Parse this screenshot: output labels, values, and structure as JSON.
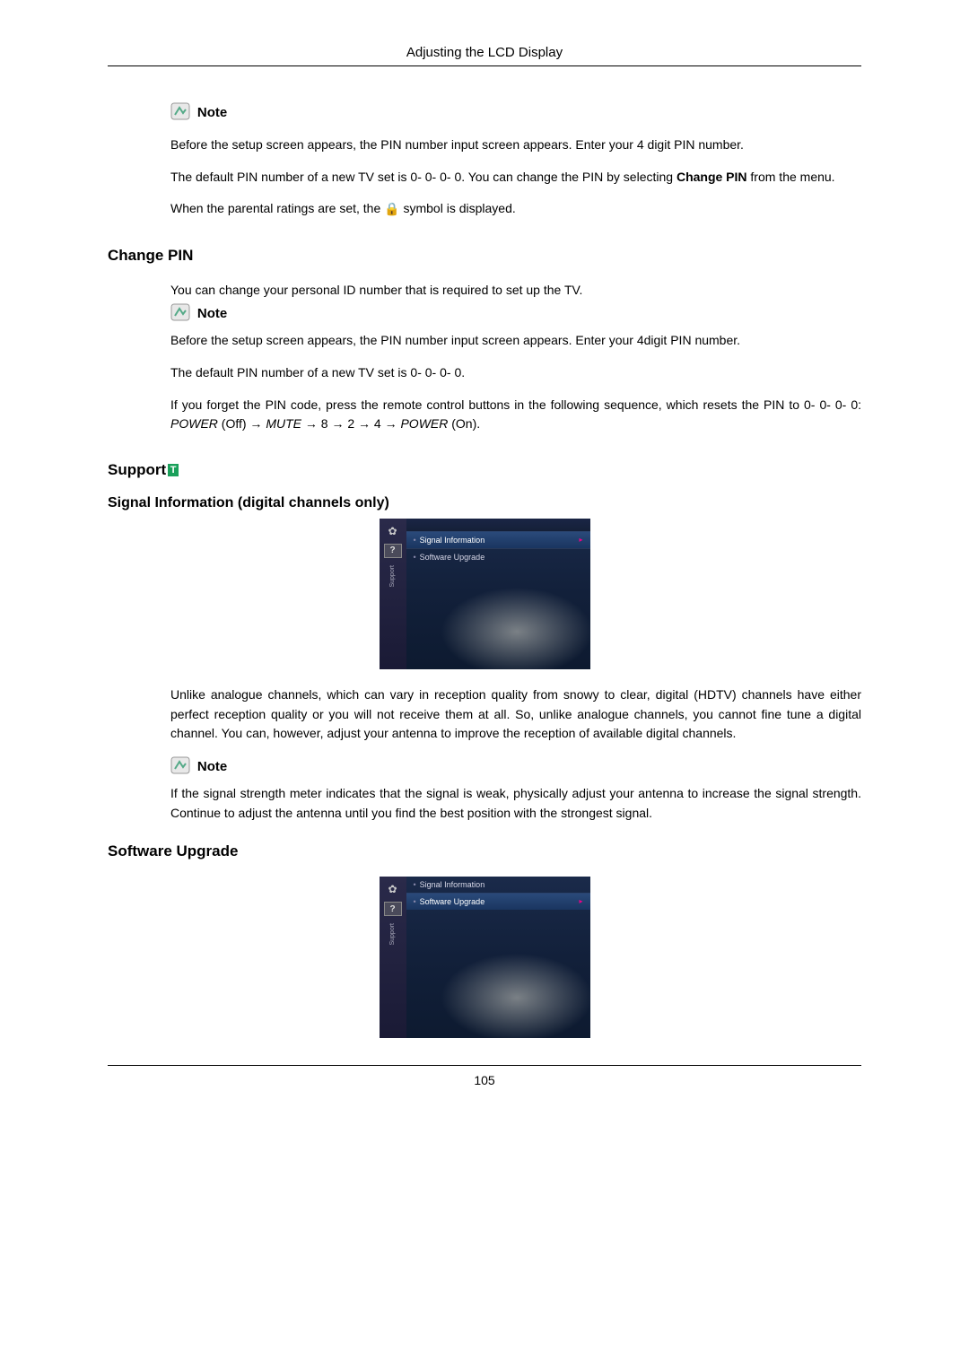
{
  "header": {
    "title": "Adjusting the LCD Display"
  },
  "note1": {
    "label": "Note",
    "p1_a": "Before the setup screen appears, the PIN number input screen appears. Enter your 4 digit PIN number.",
    "p2_a": "The default PIN number of a new TV set is 0- 0- 0- 0. You can change the PIN by selecting ",
    "p2_bold": "Change PIN",
    "p2_b": " from the menu.",
    "p3_a": "When the parental ratings are set, the ",
    "p3_b": " symbol is displayed."
  },
  "changepin": {
    "heading": "Change PIN",
    "p1": "You can change your personal ID number that is required to set up the TV.",
    "note_label": "Note",
    "p2": "Before the setup screen appears, the PIN number input screen appears. Enter your 4digit PIN number.",
    "p3": "The default PIN number of a new TV set is 0- 0- 0- 0.",
    "p4_a": "If you forget the PIN code, press the remote control buttons in the following sequence, which resets the PIN to 0- 0- 0- 0: ",
    "p4_i1": "POWER",
    "p4_b": " (Off) → ",
    "p4_i2": "MUTE",
    "p4_c": " → 8 → 2 → 4 → ",
    "p4_i3": "POWER",
    "p4_d": " (On)."
  },
  "support": {
    "heading": "Support",
    "badge": "T",
    "signal_heading": "Signal Information (digital channels only)",
    "menu": {
      "sidebar_label": "Support",
      "item1": "Signal Information",
      "item2": "Software Upgrade"
    },
    "p1": "Unlike analogue channels, which can vary in reception quality from snowy to clear, digital (HDTV) channels have either perfect reception quality or you will not receive them at all. So, unlike analogue channels, you cannot fine tune a digital channel. You can, however, adjust your antenna to improve the reception of available digital channels.",
    "note_label": "Note",
    "p2": "If the signal strength meter indicates that the signal is weak, physically adjust your antenna to increase the signal strength. Continue to adjust the antenna until you find the best position with the strongest signal."
  },
  "swupgrade": {
    "heading": "Software Upgrade",
    "menu": {
      "sidebar_label": "Support",
      "item1": "Signal Information",
      "item2": "Software Upgrade"
    }
  },
  "footer": {
    "page": "105"
  }
}
